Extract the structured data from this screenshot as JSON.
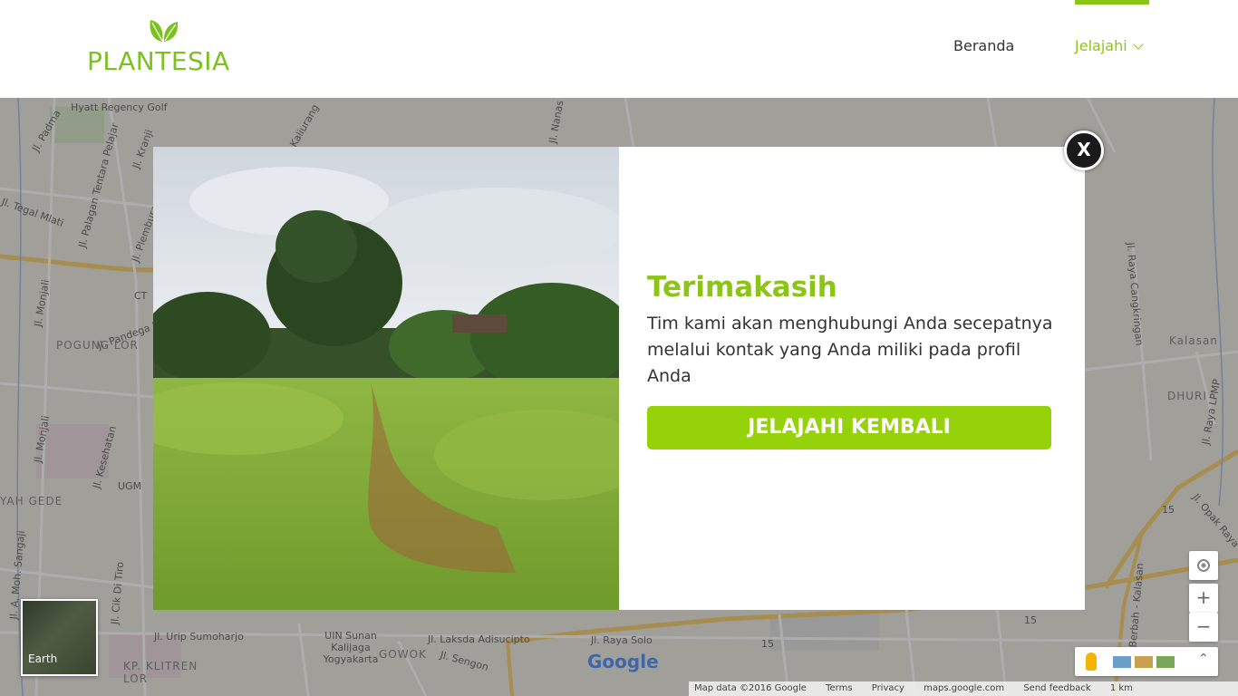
{
  "header": {
    "logo_text": "PLANTESIA",
    "nav": {
      "beranda": "Beranda",
      "jelajahi": "Jelajahi"
    }
  },
  "modal": {
    "title": "Terimakasih",
    "message": "Tim kami akan menghubungi Anda secepatnya melalui kontak yang Anda miliki pada profil Anda",
    "button_label": "JELAJAHI KEMBALI",
    "close_label": "X"
  },
  "map": {
    "labels": {
      "hyatt": "Hyatt Regency Golf",
      "padma": "Jl. Padma",
      "tegal_mlati": "Jl. Tegal Mlati",
      "palagan": "Jl. Palagan Tentara Pelajar",
      "kranji": "Jl. Kranji",
      "plemburan": "Jl. Plemburan",
      "kaliurang": "Jl. Kaliurang",
      "nanas": "Jl. Nanas",
      "monjali": "Jl. Monjali",
      "pandega": "Jl. Pandega M",
      "pogung_lor": "POGUNG LOR",
      "kesehatan": "Jl. Kesehatan",
      "ugm": "UGM",
      "yah_gede": "YAH GEDE",
      "moh_sangaji": "Jl. A. Moh. Sangaji",
      "cik_di_tiro": "Jl. Cik Di Tiro",
      "urip": "Jl. Urip Sumoharjo",
      "uin": "UIN Sunan Kalijaga Yogyakarta",
      "gowok": "GOWOK",
      "laksda": "Jl. Laksda Adisucipto",
      "sengon": "Jl. Sengon",
      "raya_solo": "Jl. Raya Solo",
      "klitren": "KP. KLITREN LOR",
      "kalasan": "Kalasan",
      "dhuri": "DHURI",
      "cangkringan": "Jl. Raya Cangkringan",
      "lpmp": "Jl. Raya LPMP",
      "opak": "Jl. Opak Raya",
      "berbah": "Jl. Berbah - Kalasan",
      "route_15": "15",
      "ct": "CT",
      "earth": "Earth"
    },
    "google_logo": "Google",
    "footer": {
      "map_data": "Map data ©2016 Google",
      "terms": "Terms",
      "privacy": "Privacy",
      "site": "maps.google.com",
      "feedback": "Send feedback",
      "scale": "1 km"
    },
    "controls": {
      "zoom_in": "+",
      "zoom_out": "−",
      "collapse": "⌃"
    }
  }
}
